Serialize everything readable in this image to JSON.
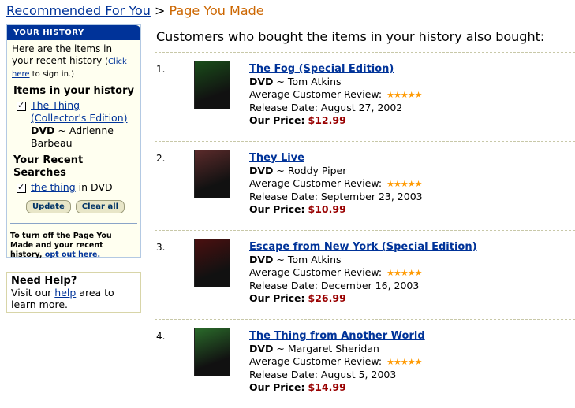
{
  "breadcrumb": {
    "link": "Recommended For You",
    "sep": ">",
    "current": "Page You Made"
  },
  "sidebar": {
    "header": "YOUR HISTORY",
    "intro_line1": "Here are the items in",
    "intro_line2": "your recent history",
    "click_here": "Click here",
    "intro_suffix": " to sign in.)",
    "items_heading": "Items in your history",
    "history_item": {
      "link": "The Thing (Collector's Edition)",
      "format": "DVD",
      "person": "~ Adrienne Barbeau"
    },
    "searches_heading": "Your Recent Searches",
    "search_item": {
      "link": "the thing",
      "suffix": " in DVD"
    },
    "update_label": "Update",
    "clear_label": "Clear all",
    "optout_text": "To turn off the Page You Made and your recent history, ",
    "optout_link": "opt out here."
  },
  "help": {
    "title": "Need Help?",
    "prefix": "Visit our ",
    "link": "help",
    "suffix": " area to learn more."
  },
  "main": {
    "heading": "Customers who bought the items in your history also bought:",
    "products": [
      {
        "num": "1.",
        "title": "The Fog (Special Edition)",
        "format": "DVD",
        "person": "~ Tom Atkins",
        "review_label": "Average Customer Review:",
        "release": "Release Date: August 27, 2002",
        "price_label": "Our Price:",
        "price": "$12.99",
        "rating": 4.5,
        "cover_color": "#1a4d1a"
      },
      {
        "num": "2.",
        "title": "They Live",
        "format": "DVD",
        "person": "~ Roddy Piper",
        "review_label": "Average Customer Review:",
        "release": "Release Date: September 23, 2003",
        "price_label": "Our Price:",
        "price": "$10.99",
        "rating": 4.5,
        "cover_color": "#5a2a2a"
      },
      {
        "num": "3.",
        "title": "Escape from New York (Special Edition)",
        "format": "DVD",
        "person": "~ Tom Atkins",
        "review_label": "Average Customer Review:",
        "release": "Release Date: December 16, 2003",
        "price_label": "Our Price:",
        "price": "$26.99",
        "rating": 4.5,
        "cover_color": "#4a1010"
      },
      {
        "num": "4.",
        "title": "The Thing from Another World",
        "format": "DVD",
        "person": "~ Margaret Sheridan",
        "review_label": "Average Customer Review:",
        "release": "Release Date: August 5, 2003",
        "price_label": "Our Price:",
        "price": "$14.99",
        "rating": 4.5,
        "cover_color": "#2a6a2a"
      }
    ]
  }
}
